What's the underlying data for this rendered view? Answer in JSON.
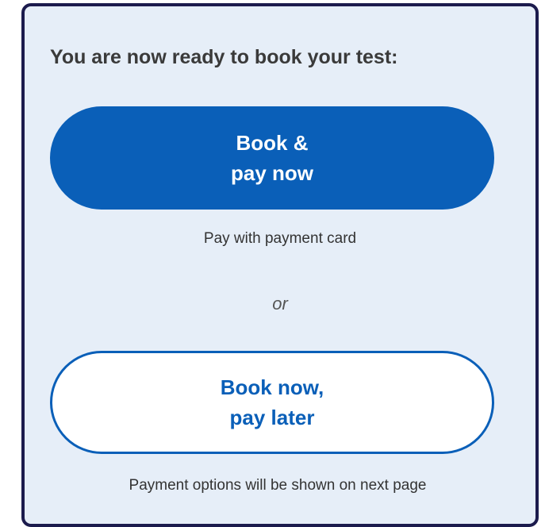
{
  "booking": {
    "heading": "You are now ready to book your test:",
    "pay_now_button": {
      "line1": "Book &",
      "line2": "pay now"
    },
    "pay_now_caption": "Pay with payment card",
    "separator": "or",
    "pay_later_button": {
      "line1": "Book now,",
      "line2": "pay later"
    },
    "pay_later_caption": "Payment options will be shown on next page"
  },
  "colors": {
    "panel_background": "#e6eef8",
    "panel_border": "#1c1b4d",
    "primary": "#0a5fb8"
  }
}
